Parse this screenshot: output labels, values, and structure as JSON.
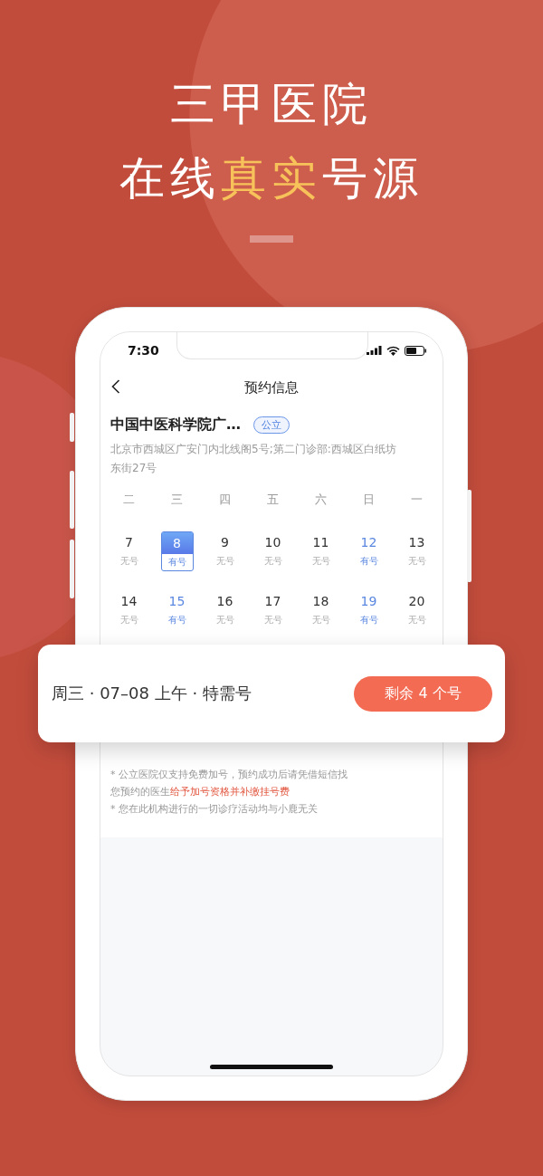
{
  "headline": {
    "lines": [
      [
        {
          "text": "三甲医院",
          "highlight": false
        }
      ],
      [
        {
          "text": "在线",
          "highlight": false
        },
        {
          "text": "真实",
          "highlight": true
        },
        {
          "text": "号源",
          "highlight": false
        }
      ]
    ]
  },
  "status_bar": {
    "time": "7:30"
  },
  "nav": {
    "title": "预约信息"
  },
  "hospital": {
    "name": "中国中医科学院广…",
    "tag": "公立",
    "address": "北京市西城区广安门内北线阁5号;第二门诊部:西城区白纸坊东街27号"
  },
  "calendar": {
    "weekdays": [
      "二",
      "三",
      "四",
      "五",
      "六",
      "日",
      "一"
    ],
    "days": [
      {
        "day": "7",
        "status": "无号",
        "available": false,
        "selected": false
      },
      {
        "day": "8",
        "status": "有号",
        "available": true,
        "selected": true
      },
      {
        "day": "9",
        "status": "无号",
        "available": false,
        "selected": false
      },
      {
        "day": "10",
        "status": "无号",
        "available": false,
        "selected": false
      },
      {
        "day": "11",
        "status": "无号",
        "available": false,
        "selected": false
      },
      {
        "day": "12",
        "status": "有号",
        "available": true,
        "selected": false
      },
      {
        "day": "13",
        "status": "无号",
        "available": false,
        "selected": false
      },
      {
        "day": "14",
        "status": "无号",
        "available": false,
        "selected": false
      },
      {
        "day": "15",
        "status": "有号",
        "available": true,
        "selected": false
      },
      {
        "day": "16",
        "status": "无号",
        "available": false,
        "selected": false
      },
      {
        "day": "17",
        "status": "无号",
        "available": false,
        "selected": false
      },
      {
        "day": "18",
        "status": "无号",
        "available": false,
        "selected": false
      },
      {
        "day": "19",
        "status": "有号",
        "available": true,
        "selected": false
      },
      {
        "day": "20",
        "status": "无号",
        "available": false,
        "selected": false
      }
    ]
  },
  "slot_card": {
    "text": "周三 · 07–08 上午 · 特需号",
    "button": "剩余 4 个号"
  },
  "notes": [
    {
      "segments": [
        {
          "text": "* 公立医院仅支持免费加号，预约成功后请凭借短信找您预约的医生",
          "highlight": false
        },
        {
          "text": "给予加号资格并补缴挂号费",
          "highlight": true
        }
      ]
    },
    {
      "segments": [
        {
          "text": "* 您在此机构进行的一切诊疗活动均与小鹿无关",
          "highlight": false
        }
      ]
    }
  ]
}
